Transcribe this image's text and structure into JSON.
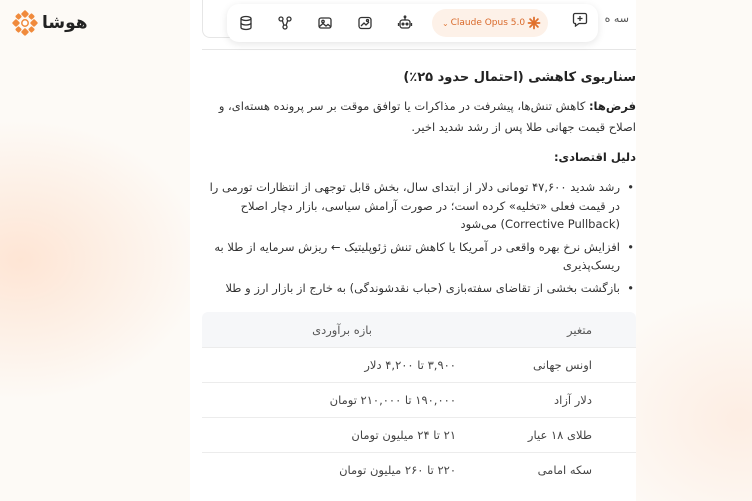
{
  "brand": {
    "name": "هوشا",
    "icon": "hosha-logo-icon",
    "color": "#f08a3c"
  },
  "toolbar": {
    "buttons": [
      {
        "name": "database-icon"
      },
      {
        "name": "workflow-icon"
      },
      {
        "name": "image-gallery-icon"
      },
      {
        "name": "image-edit-icon"
      },
      {
        "name": "robot-icon"
      }
    ],
    "model_label": "Claude Opus 5.0",
    "model_icon": "claude-star-icon",
    "new_chat_icon": "new-chat-icon",
    "cut_text": "سه ه"
  },
  "colors": {
    "accent": "#e07a3a",
    "pill_bg": "#fdf1e8"
  },
  "article": {
    "title": "سناریوی کاهشی (احتمال حدود ۲۵٪)",
    "assumptions_label": "فرض‌ها:",
    "assumptions_text": " کاهش تنش‌ها، پیشرفت در مذاکرات یا توافق موقت بر سر پرونده هسته‌ای، و اصلاح قیمت جهانی طلا پس از رشد شدید اخیر.",
    "reasons_title": "دلیل اقتصادی:",
    "bullets": [
      "رشد شدید ۴۷,۶۰۰ تومانی دلار از ابتدای سال، بخش قابل توجهی از انتظارات تورمی را در قیمت فعلی «تخلیه» کرده است؛ در صورت آرامش سیاسی، بازار دچار اصلاح (Corrective Pullback) می‌شود",
      "افزایش نرخ بهره واقعی در آمریکا یا کاهش تنش ژئوپلیتیک ← ریزش سرمایه از طلا به ریسک‌پذیری",
      "بازگشت بخشی از تقاضای سفته‌بازی (حباب نقدشوندگی) به خارج از بازار ارز و طلا"
    ]
  },
  "table": {
    "headers": [
      "متغیر",
      "بازه برآوردی"
    ],
    "rows": [
      [
        "اونس جهانی",
        "۳,۹۰۰ تا ۴,۲۰۰ دلار"
      ],
      [
        "دلار آزاد",
        "۱۹۰,۰۰۰ تا ۲۱۰,۰۰۰ تومان"
      ],
      [
        "طلای ۱۸ عیار",
        "۲۱ تا ۲۴ میلیون تومان"
      ],
      [
        "سکه امامی",
        "۲۲۰ تا ۲۶۰ میلیون تومان"
      ]
    ]
  }
}
